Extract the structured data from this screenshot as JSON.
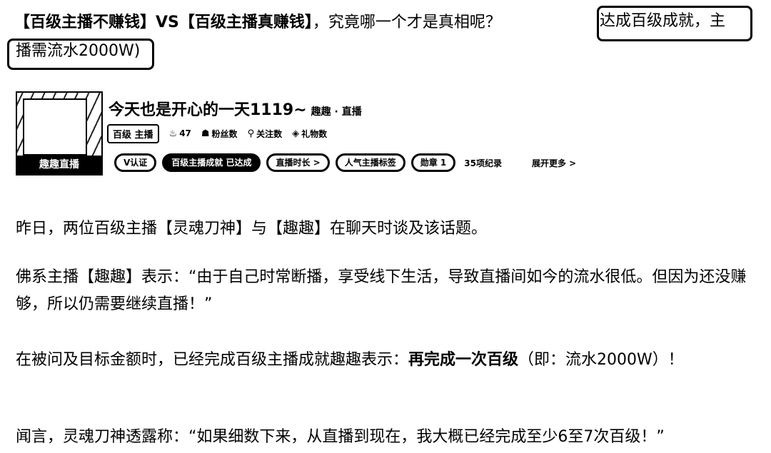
{
  "headline": {
    "main": "【百级主播不赚钱】VS【百级主播真赚钱】",
    "question": "，究竟哪一个才是真相呢？",
    "note_line1": "达成百级成就，主",
    "note_line2": "播需流水2000W)"
  },
  "streamer": {
    "avatar_caption": "趣趣直播",
    "name": "今天也是开心的一天1119~",
    "name_extra": "趣趣 · 直播",
    "level": "百级 主播",
    "stats": [
      {
        "icon": "flame-icon",
        "glyph": "♨",
        "value": "47"
      },
      {
        "icon": "fans-icon",
        "glyph": "☗",
        "value": "粉丝数"
      },
      {
        "icon": "pin-icon",
        "glyph": "⚲",
        "value": "关注数"
      },
      {
        "icon": "tag-icon",
        "glyph": "◈",
        "value": "礼物数"
      }
    ],
    "tags": [
      {
        "label": "V认证",
        "dark": false
      },
      {
        "label": "百级主播成就 已达成",
        "dark": true
      },
      {
        "label": "直播时长 >",
        "dark": false
      },
      {
        "label": "人气主播标签",
        "dark": false
      },
      {
        "label": "勋章 1",
        "dark": false
      }
    ],
    "tag_plain": "35项纪录",
    "tag_more": "展开更多 >"
  },
  "body": {
    "p1": "昨日，两位百级主播【灵魂刀神】与【趣趣】在聊天时谈及该话题。",
    "p2": "佛系主播【趣趣】表示：“由于自己时常断播，享受线下生活，导致直播间如今的流水很低。但因为还没赚够，所以仍需要继续直播！”",
    "p3_before": "在被问及目标金额时，已经完成百级主播成就趣趣表示：",
    "p3_bold": "再完成一次百级",
    "p3_after": "（即：流水2000W）！",
    "p4": "闻言，灵魂刀神透露称：“如果细数下来，从直播到现在，我大概已经完成至少6至7次百级！”"
  }
}
